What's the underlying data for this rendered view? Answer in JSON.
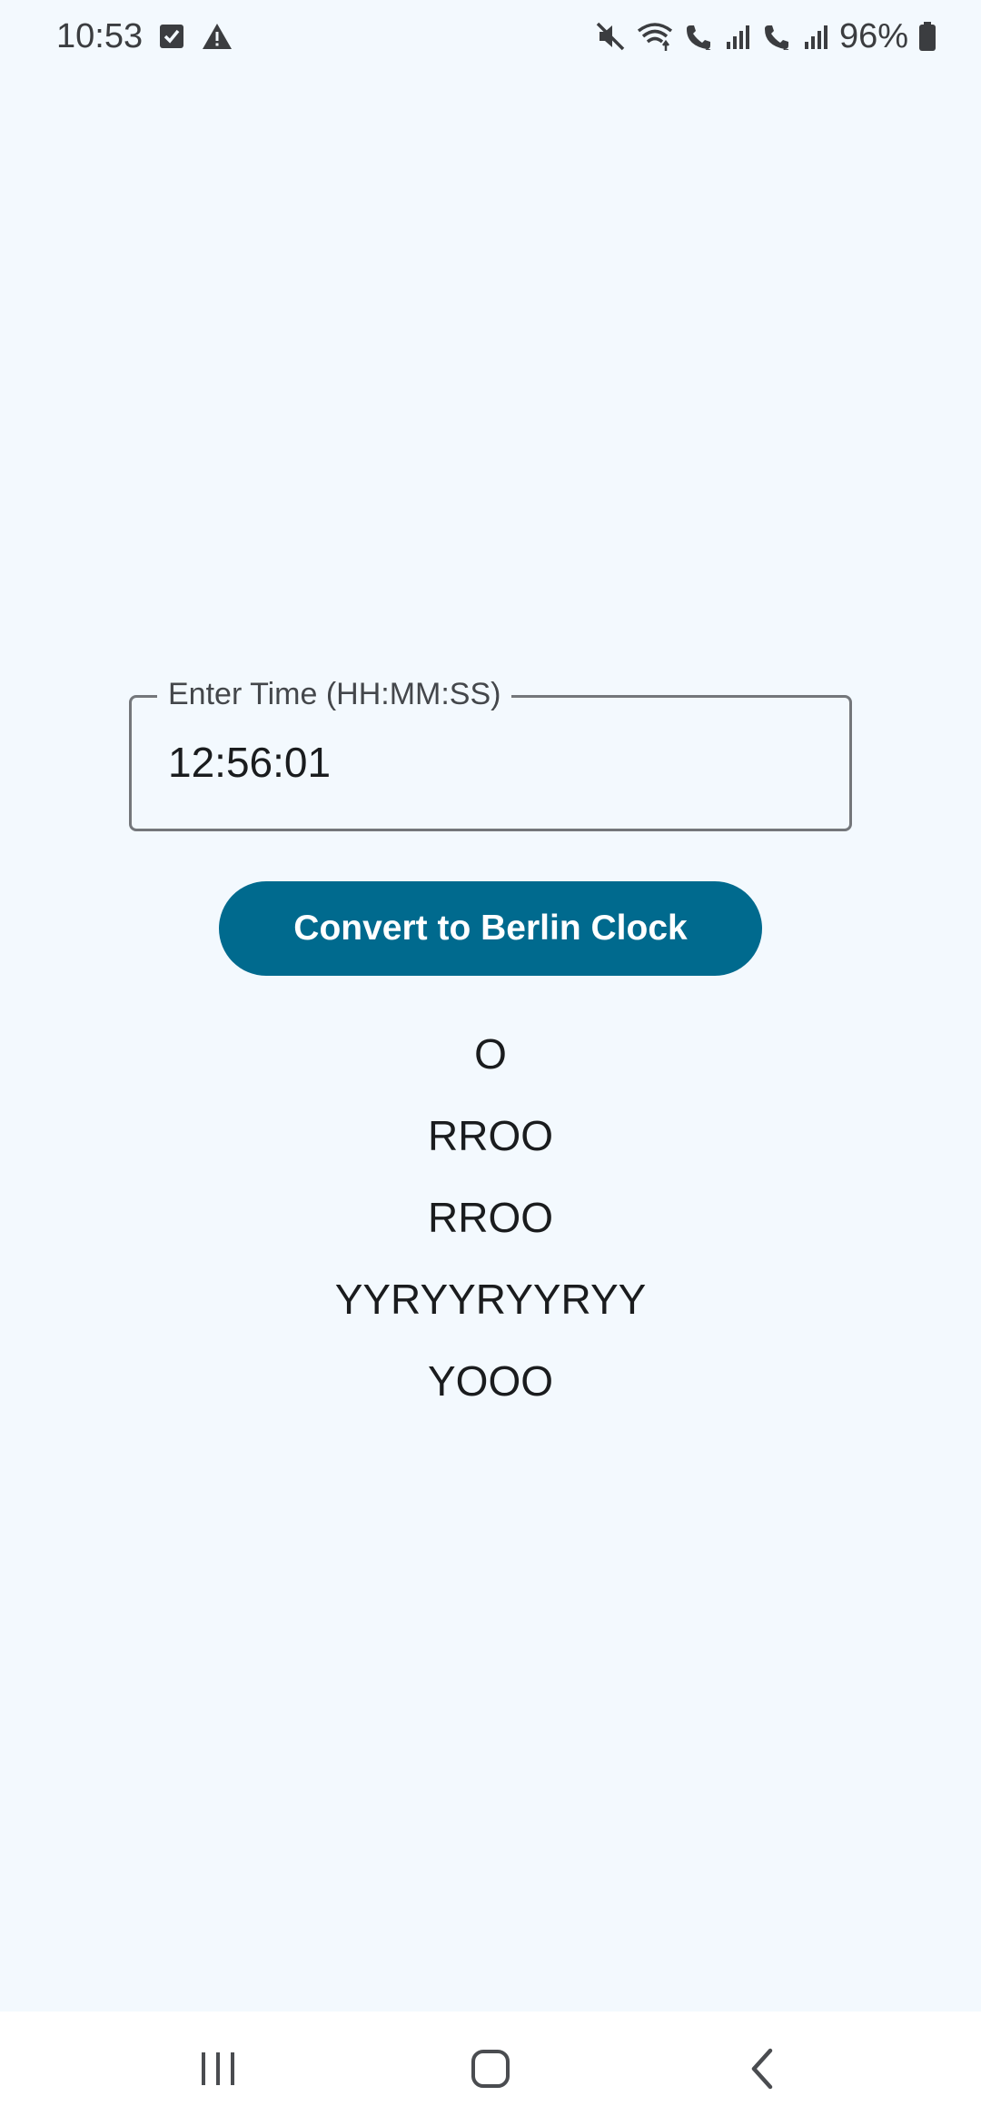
{
  "status_bar": {
    "time": "10:53",
    "battery_percent": "96%",
    "icons_left": [
      "checkbox-notification-icon",
      "warning-icon"
    ],
    "icons_right": [
      "mute-icon",
      "wifi-icon",
      "wifi-call-sim1-icon",
      "signal-icon",
      "wifi-call-sim2-icon",
      "signal-icon",
      "battery-icon"
    ]
  },
  "time_field": {
    "label": "Enter Time (HH:MM:SS)",
    "value": "12:56:01"
  },
  "convert_button": {
    "label": "Convert to Berlin Clock",
    "color": "#006a8e"
  },
  "results": [
    "O",
    "RROO",
    "RROO",
    "YYRYYRYYRYY",
    "YOOO"
  ],
  "nav_bar": {
    "buttons": [
      "recent-apps-icon",
      "home-icon",
      "back-icon"
    ]
  },
  "colors": {
    "background": "#f3f9fe",
    "primary": "#006a8e",
    "outline": "#74777b"
  }
}
